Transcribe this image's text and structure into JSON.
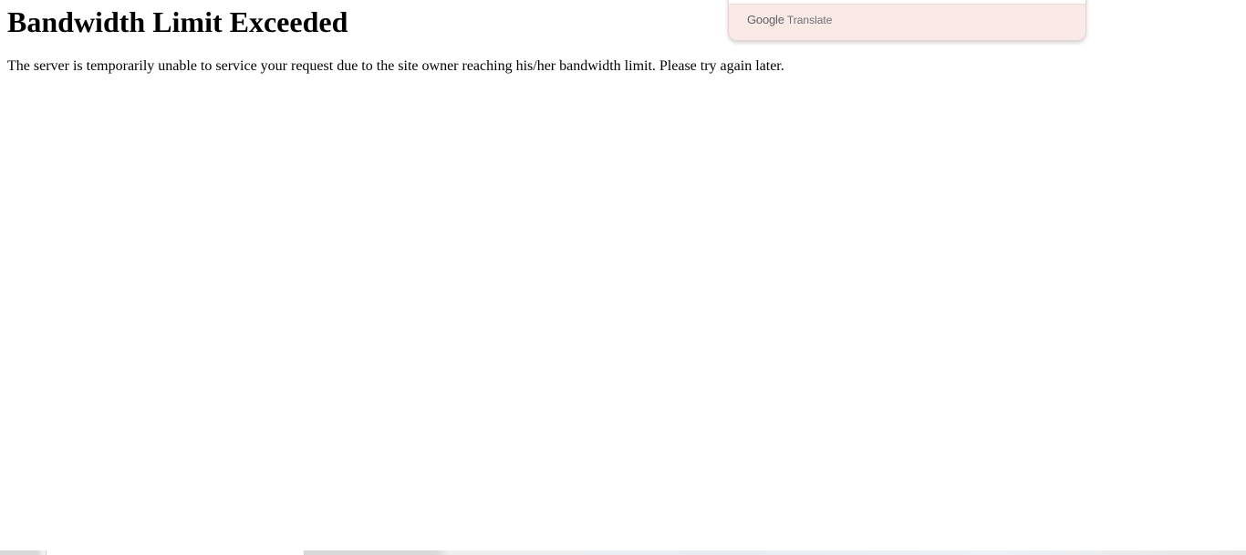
{
  "page": {
    "title": "Bandwidth Limit Exceeded",
    "message": "The server is temporarily unable to service your request due to the site owner reaching his/her bandwidth limit. Please try again later."
  },
  "translate_widget": {
    "brand": "Google",
    "product": "Translate",
    "background_color": "#fbe9e5"
  }
}
